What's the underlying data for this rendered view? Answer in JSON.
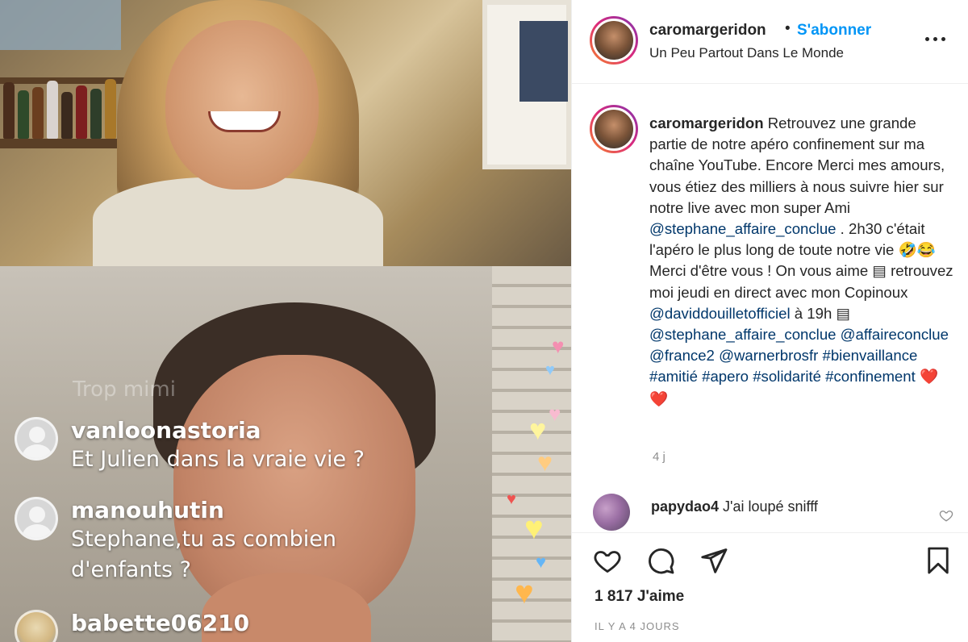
{
  "live": {
    "faded_comment": "Trop mimi",
    "comments": [
      {
        "user": "vanloonastoria",
        "message": "Et Julien dans la vraie vie ?"
      },
      {
        "user": "manouhutin",
        "message": "Stephane,tu as combien d'enfants ?"
      },
      {
        "user": "babette06210",
        "message": ""
      }
    ]
  },
  "post": {
    "header": {
      "username": "caromargeridon",
      "separator": "•",
      "follow_label": "S'abonner",
      "location": "Un Peu Partout Dans Le Monde"
    },
    "caption": {
      "username": "caromargeridon",
      "text_1": "Retrouvez une grande partie de notre apéro confinement sur ma chaîne YouTube. Encore Merci mes amours, vous étiez des milliers à nous suivre hier sur notre live avec mon super Ami",
      "mention_1": "@stephane_affaire_conclue",
      "text_2": ". 2h30 c'était l'apéro le plus long de toute notre vie 🤣😂Merci d'être vous ! On vous aime ▤ retrouvez moi jeudi en direct avec mon Copinoux",
      "mention_2": "@daviddouilletofficiel",
      "text_3": "à 19h ▤",
      "mention_3": "@stephane_affaire_conclue",
      "mention_4": "@affaireconclue",
      "mention_5": "@france2",
      "mention_6": "@warnerbrosfr",
      "hashtag_1": "#bienvaillance",
      "hashtag_2": "#amitié",
      "hashtag_3": "#apero",
      "hashtag_4": "#solidarité",
      "hashtag_5": "#confinement",
      "hearts": "❤️❤️"
    },
    "caption_age": "4 j",
    "comment": {
      "username": "papydao4",
      "text": "J'ai loupé snifff"
    },
    "likes": "1 817 J'aime",
    "date": "Il y a 4 jours"
  },
  "icons": {
    "like": "heart-icon",
    "comment": "comment-bubble-icon",
    "share": "paper-plane-icon",
    "save": "bookmark-icon",
    "more": "more-dots-icon"
  },
  "colors": {
    "follow_blue": "#0095f6",
    "mention_blue": "#00376b",
    "meta_grey": "#8e8e8e"
  }
}
